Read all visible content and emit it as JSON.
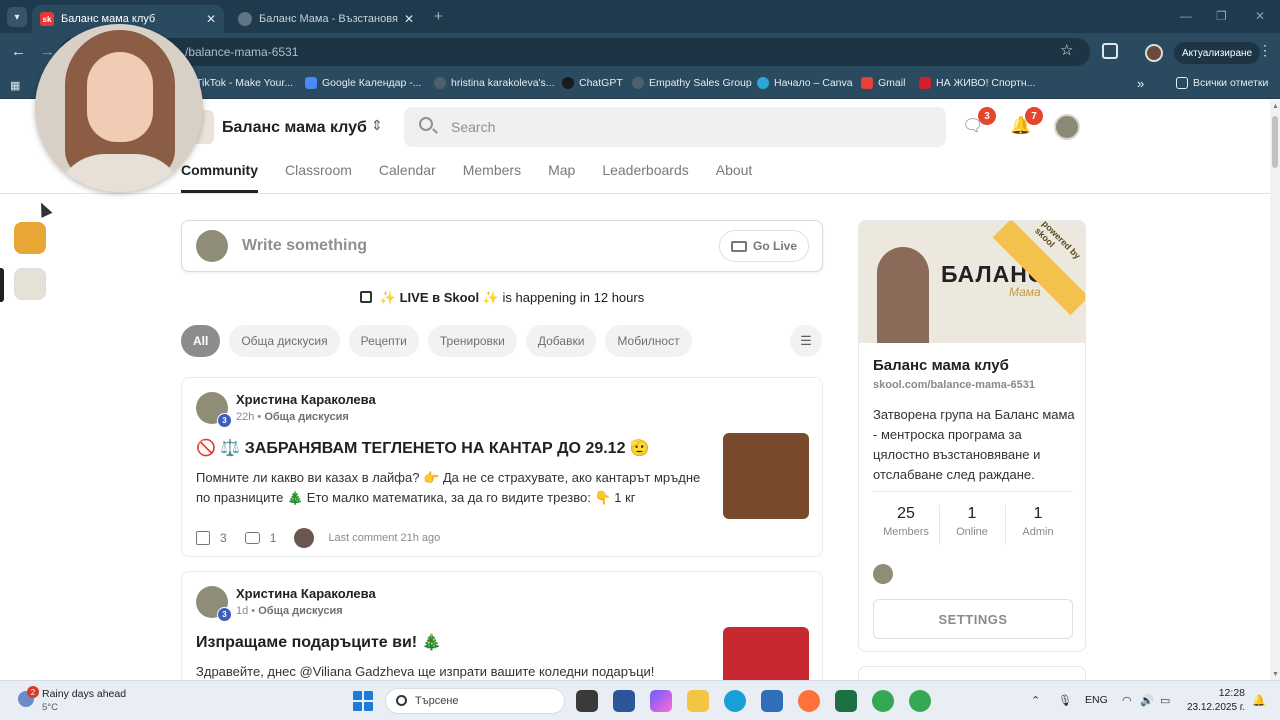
{
  "browser": {
    "tabs": [
      {
        "title": "Баланс мама клуб",
        "favicon_text": "sk"
      },
      {
        "title": "Баланс Мама - Възстановяване"
      }
    ],
    "address": "/balance-mama-6531",
    "update_label": "Актуализиране",
    "bookmarks": [
      "TikTok - Make Your...",
      "Google Календар -...",
      "hristina karakoleva's...",
      "ChatGPT",
      "Empathy Sales Group",
      "Начало – Canva",
      "Gmail",
      "НА ЖИВО! Спортн..."
    ],
    "bookmarks_folder": "Всички отметки"
  },
  "header": {
    "group_name": "Баланс мама клуб",
    "search_placeholder": "Search",
    "chat_badge": "3",
    "notifications_badge": "7"
  },
  "nav": {
    "tabs": [
      "Community",
      "Classroom",
      "Calendar",
      "Members",
      "Map",
      "Leaderboards",
      "About"
    ],
    "active": "Community"
  },
  "composer": {
    "placeholder": "Write something",
    "go_live": "Go Live"
  },
  "live_banner": {
    "prefix": "✨",
    "name": "LIVE в Skool",
    "suffix": "✨",
    "text": "is happening in 12 hours"
  },
  "filters": [
    "All",
    "Обща дискусия",
    "Рецепти",
    "Тренировки",
    "Добавки",
    "Мобилност"
  ],
  "posts": [
    {
      "author": "Христина Караколева",
      "level": "3",
      "time": "22h",
      "category": "Обща дискусия",
      "title": "🚫 ⚖️ ЗАБРАНЯВАМ ТЕГЛЕНЕТО НА КАНТАР ДО 29.12 🫡",
      "body": "Помните ли какво ви казах в лайфа? 👉 Да не се страхувате, ако кантарът мръдне по празниците 🎄 Ето малко математика, за да го видите трезво: 👇 1 кг",
      "likes": "3",
      "comments": "1",
      "last_comment": "Last comment 21h ago"
    },
    {
      "author": "Христина Караколева",
      "level": "3",
      "time": "1d",
      "category": "Обща дискусия",
      "title": "Изпращаме подаръците ви! 🎄",
      "body": "Здравейте, днес @Viliana Gadzheva ще изпрати вашите коледни подаръци!"
    }
  ],
  "sidebar_card": {
    "banner_text": "БАЛАНС",
    "banner_script": "Мама",
    "ribbon": "powered by skool",
    "name": "Баланс мама клуб",
    "url": "skool.com/balance-mama-6531",
    "description": "Затворена група на Баланс мама - ментроска програма за цялостно възстановяване и отслабване след раждане.",
    "stats": [
      {
        "value": "25",
        "label": "Members"
      },
      {
        "value": "1",
        "label": "Online"
      },
      {
        "value": "1",
        "label": "Admin"
      }
    ],
    "settings": "SETTINGS"
  },
  "taskbar": {
    "weather_title": "Rainy days ahead",
    "weather_temp": "5°C",
    "weather_badge": "2",
    "search_text": "Търсене",
    "lang": "ENG",
    "time": "12:28",
    "date": "23.12.2025 г."
  },
  "colors": {
    "chrome_dark": "#1f3a4d",
    "chrome": "#2a4a60",
    "badge_red": "#e5452f",
    "level_blue": "#3e5dbf",
    "ribbon_yellow": "#f2c14e"
  }
}
